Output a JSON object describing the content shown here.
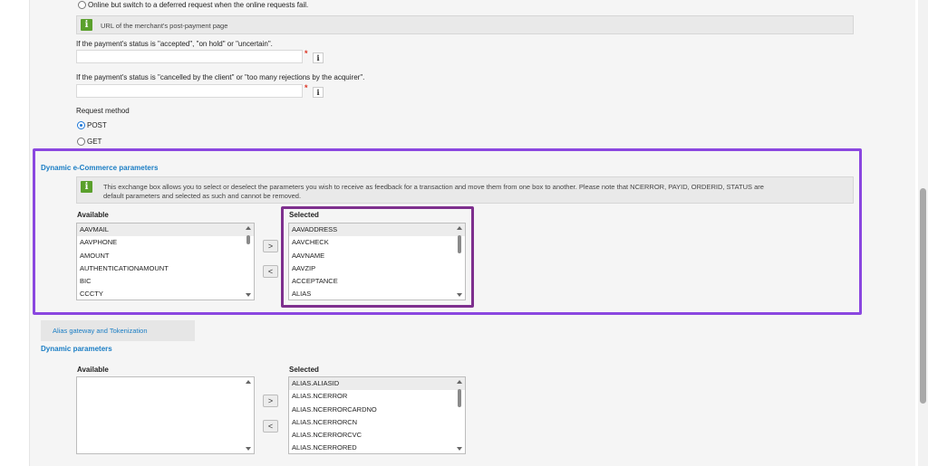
{
  "top": {
    "option_deferred_label": "Online but switch to a deferred request when the online requests fail.",
    "post_payment_info": "URL of the merchant's post-payment page",
    "accepted_label": "If the payment's status is \"accepted\", \"on hold\" or \"uncertain\".",
    "cancelled_label": "If the payment's status is \"cancelled by the client\" or \"too many rejections by the acquirer\".",
    "required_mark": "*",
    "info_button": "i",
    "request_method_label": "Request method",
    "method_post": "POST",
    "method_get": "GET",
    "selected_method": "POST"
  },
  "ecommerce": {
    "title": "Dynamic e-Commerce parameters",
    "info_line1": "This exchange box allows you to select or deselect the parameters you wish to receive as feedback for a transaction and move them from one box to another. Please note that NCERROR, PAYID, ORDERID, STATUS are",
    "info_line2": "default parameters and selected as such and cannot be removed.",
    "available_header": "Available",
    "selected_header": "Selected",
    "available_items": [
      "AAVMAIL",
      "AAVPHONE",
      "AMOUNT",
      "AUTHENTICATIONAMOUNT",
      "BIC",
      "CCCTY"
    ],
    "selected_items": [
      "AAVADDRESS",
      "AAVCHECK",
      "AAVNAME",
      "AAVZIP",
      "ACCEPTANCE",
      "ALIAS"
    ],
    "add_button": ">",
    "remove_button": "<"
  },
  "tabs": {
    "alias_tab_label": "Alias gateway and Tokenization"
  },
  "dynamic": {
    "title": "Dynamic parameters",
    "available_header": "Available",
    "selected_header": "Selected",
    "available_items": [],
    "selected_items": [
      "ALIAS.ALIASID",
      "ALIAS.NCERROR",
      "ALIAS.NCERRORCARDNO",
      "ALIAS.NCERRORCN",
      "ALIAS.NCERRORCVC",
      "ALIAS.NCERRORED"
    ],
    "add_button": ">",
    "remove_button": "<"
  },
  "colors": {
    "accent_blue": "#1a7dc4",
    "info_green": "#5aa02c",
    "highlight_outer": "#8b47e0",
    "highlight_inner": "#7e2f8e"
  }
}
